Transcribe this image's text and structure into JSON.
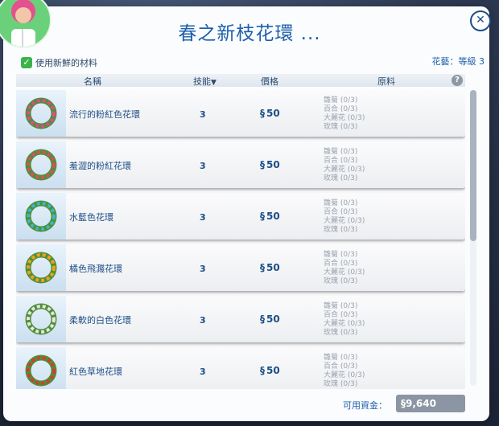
{
  "title": "春之新枝花環 ...",
  "fresh_ingredients_label": "使用新鮮的材料",
  "skill_label": "花藝：等級 3",
  "columns": {
    "name": "名稱",
    "skill": "技能",
    "price": "價格",
    "ingredients": "原料"
  },
  "items": [
    {
      "name": "流行的粉紅色花環",
      "skill": "3",
      "price": "50",
      "wreath_color": "#e24a8b"
    },
    {
      "name": "羞澀的粉紅花環",
      "skill": "3",
      "price": "50",
      "wreath_color": "#d94f5c"
    },
    {
      "name": "水藍色花環",
      "skill": "3",
      "price": "50",
      "wreath_color": "#3bb7c7"
    },
    {
      "name": "橘色飛濺花環",
      "skill": "3",
      "price": "50",
      "wreath_color": "#f0a21b"
    },
    {
      "name": "柔軟的白色花環",
      "skill": "3",
      "price": "50",
      "wreath_color": "#e6e6de"
    },
    {
      "name": "紅色草地花環",
      "skill": "3",
      "price": "50",
      "wreath_color": "#d63b2f"
    }
  ],
  "ingredients": [
    "雛菊 (0/3)",
    "百合 (0/3)",
    "大麗花 (0/3)",
    "玫瑰 (0/3)"
  ],
  "currency_symbol": "§",
  "funds_label": "可用資金：",
  "funds_value": "9,640",
  "scroll_position": 0.0
}
